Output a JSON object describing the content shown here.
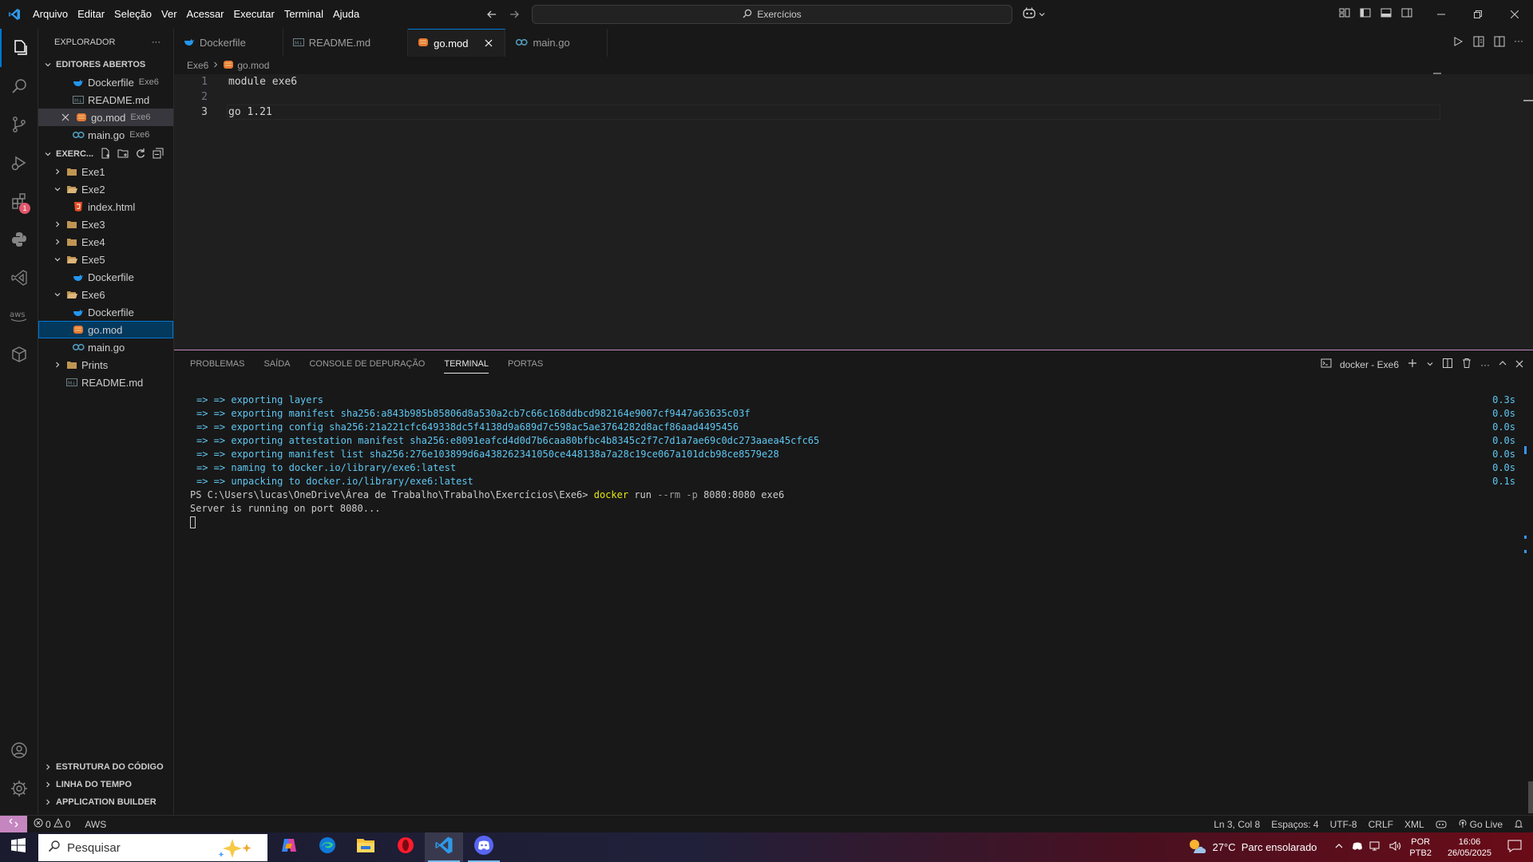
{
  "titlebar": {
    "menu": [
      "Arquivo",
      "Editar",
      "Seleção",
      "Ver",
      "Acessar",
      "Executar",
      "Terminal",
      "Ajuda"
    ],
    "search_text": "Exercícios"
  },
  "explorer": {
    "header": "EXPLORADOR",
    "open_editors_title": "EDITORES ABERTOS",
    "open_editors": [
      {
        "name": "Dockerfile",
        "desc": "Exe6"
      },
      {
        "name": "README.md",
        "desc": ""
      },
      {
        "name": "go.mod",
        "desc": "Exe6"
      },
      {
        "name": "main.go",
        "desc": "Exe6"
      }
    ],
    "workspace_title": "EXERC...",
    "tree": [
      {
        "name": "Exe1"
      },
      {
        "name": "Exe2"
      },
      {
        "name": "index.html"
      },
      {
        "name": "Exe3"
      },
      {
        "name": "Exe4"
      },
      {
        "name": "Exe5"
      },
      {
        "name": "Dockerfile"
      },
      {
        "name": "Exe6"
      },
      {
        "name": "Dockerfile"
      },
      {
        "name": "go.mod"
      },
      {
        "name": "main.go"
      },
      {
        "name": "Prints"
      },
      {
        "name": "README.md"
      }
    ],
    "bottom_sections": [
      "ESTRUTURA DO CÓDIGO",
      "LINHA DO TEMPO",
      "APPLICATION BUILDER"
    ]
  },
  "activity_badge": "1",
  "tabs": [
    "Dockerfile",
    "README.md",
    "go.mod",
    "main.go"
  ],
  "breadcrumb": {
    "folder": "Exe6",
    "file": "go.mod"
  },
  "editor": {
    "lines": [
      {
        "n": "1",
        "text": "module exe6"
      },
      {
        "n": "2",
        "text": ""
      },
      {
        "n": "3",
        "text": "go 1.21"
      }
    ]
  },
  "panel": {
    "tabs": [
      "PROBLEMAS",
      "SAÍDA",
      "CONSOLE DE DEPURAÇÃO",
      "TERMINAL",
      "PORTAS"
    ],
    "terminal_name": "docker - Exe6",
    "output": [
      {
        "text": "=> => exporting layers",
        "time": "0.3s"
      },
      {
        "text": "=> => exporting manifest sha256:a843b985b85806d8a530a2cb7c66c168ddbcd982164e9007cf9447a63635c03f",
        "time": "0.0s"
      },
      {
        "text": "=> => exporting config sha256:21a221cfc649338dc5f4138d9a689d7c598ac5ae3764282d8acf86aad4495456",
        "time": "0.0s"
      },
      {
        "text": "=> => exporting attestation manifest sha256:e8091eafcd4d0d7b6caa80bfbc4b8345c2f7c7d1a7ae69c0dc273aaea45cfc65",
        "time": "0.0s"
      },
      {
        "text": "=> => exporting manifest list sha256:276e103899d6a438262341050ce448138a7a28c19ce067a101dcb98ce8579e28",
        "time": "0.0s"
      },
      {
        "text": "=> => naming to docker.io/library/exe6:latest",
        "time": "0.0s"
      },
      {
        "text": "=> => unpacking to docker.io/library/exe6:latest",
        "time": "0.1s"
      }
    ],
    "prompt": "PS C:\\Users\\lucas\\OneDrive\\Área de Trabalho\\Trabalho\\Exercícios\\Exe6>",
    "cmd_docker": "docker",
    "cmd_run": "run",
    "cmd_flags": "--rm -p",
    "cmd_args": "8080:8080 exe6",
    "server_msg": "Server is running on port 8080..."
  },
  "statusbar": {
    "errors": "0",
    "warnings": "0",
    "aws": "AWS",
    "position": "Ln 3, Col 8",
    "spaces": "Espaços: 4",
    "encoding": "UTF-8",
    "eol": "CRLF",
    "language": "XML",
    "go_live": "Go Live"
  },
  "taskbar": {
    "search_placeholder": "Pesquisar",
    "weather": "27°C  Parc ensolarado",
    "lang1": "POR",
    "lang2": "PTB2",
    "time": "16:06",
    "date": "26/05/2025"
  },
  "colors": {
    "accent": "#0078d4",
    "terminal_text": "#5fc7f2",
    "panel_border": "#c586c0",
    "remote": "#c586c0"
  }
}
